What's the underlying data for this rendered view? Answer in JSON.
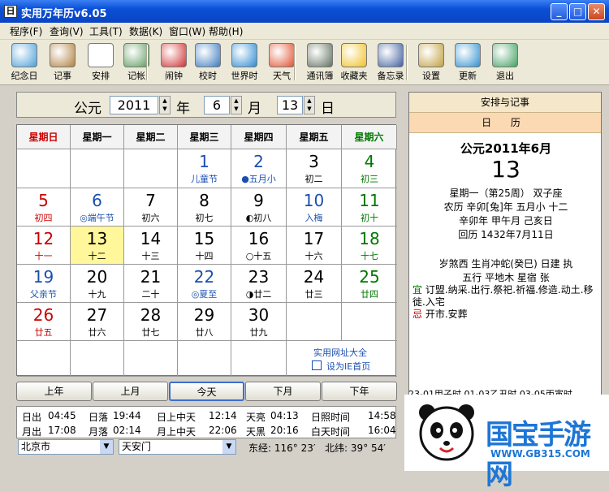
{
  "window": {
    "title": "实用万年历v6.05",
    "icon_text": "日"
  },
  "menu": [
    "程序(F)",
    "查询(V)",
    "工具(T)",
    "数据(K)",
    "窗口(W)",
    "帮助(H)"
  ],
  "toolbar": [
    {
      "label": "纪念日",
      "icon": "memorial-icon",
      "color": "#4a9fd8"
    },
    {
      "label": "记事",
      "icon": "notes-icon",
      "color": "#b08040"
    },
    {
      "label": "安排",
      "icon": "schedule-icon",
      "color": "#ffffff"
    },
    {
      "label": "记帐",
      "icon": "ledger-icon",
      "color": "#5a9a5a"
    },
    {
      "label": "闹钟",
      "icon": "alarm-icon",
      "color": "#d03030"
    },
    {
      "label": "校时",
      "icon": "clock-sync-icon",
      "color": "#3a7ac0"
    },
    {
      "label": "世界时",
      "icon": "globe-icon",
      "color": "#2a8ad0"
    },
    {
      "label": "天气",
      "icon": "weather-icon",
      "color": "#e05030"
    },
    {
      "label": "通讯簿",
      "icon": "address-book-icon",
      "color": "#607060"
    },
    {
      "label": "收藏夹",
      "icon": "favorites-icon",
      "color": "#f0c020"
    },
    {
      "label": "备忘录",
      "icon": "memo-icon",
      "color": "#4060a0"
    },
    {
      "label": "设置",
      "icon": "settings-icon",
      "color": "#c0a040"
    },
    {
      "label": "更新",
      "icon": "update-icon",
      "color": "#3090d0"
    },
    {
      "label": "退出",
      "icon": "exit-icon",
      "color": "#40a060"
    }
  ],
  "date": {
    "era": "公元",
    "year": "2011",
    "year_unit": "年",
    "month": "6",
    "month_unit": "月",
    "day": "13",
    "day_unit": "日"
  },
  "weekdays": [
    {
      "t": "星期日",
      "c": "#cc0000"
    },
    {
      "t": "星期一",
      "c": "#000"
    },
    {
      "t": "星期二",
      "c": "#000"
    },
    {
      "t": "星期三",
      "c": "#000"
    },
    {
      "t": "星期四",
      "c": "#000"
    },
    {
      "t": "星期五",
      "c": "#000"
    },
    {
      "t": "星期六",
      "c": "#007700"
    }
  ],
  "days": [
    {
      "d": "1",
      "l": "儿童节",
      "c": "#1a4fb0",
      "lc": "#1a4fb0"
    },
    {
      "d": "2",
      "l": "●五月小",
      "c": "#1a4fb0",
      "lc": "#1a4fb0"
    },
    {
      "d": "3",
      "l": "初二",
      "c": "#000",
      "lc": "#000"
    },
    {
      "d": "4",
      "l": "初三",
      "c": "#007700",
      "lc": "#007700"
    },
    {
      "d": "5",
      "l": "初四",
      "c": "#cc0000",
      "lc": "#cc0000"
    },
    {
      "d": "6",
      "l": "◎端午节",
      "c": "#1a4fb0",
      "lc": "#1a4fb0"
    },
    {
      "d": "7",
      "l": "初六",
      "c": "#000",
      "lc": "#000"
    },
    {
      "d": "8",
      "l": "初七",
      "c": "#000",
      "lc": "#000"
    },
    {
      "d": "9",
      "l": "◐初八",
      "c": "#000",
      "lc": "#000"
    },
    {
      "d": "10",
      "l": "入梅",
      "c": "#1a4fb0",
      "lc": "#1a4fb0"
    },
    {
      "d": "11",
      "l": "初十",
      "c": "#007700",
      "lc": "#007700"
    },
    {
      "d": "12",
      "l": "十一",
      "c": "#cc0000",
      "lc": "#cc0000"
    },
    {
      "d": "13",
      "l": "十二",
      "c": "#000",
      "lc": "#000"
    },
    {
      "d": "14",
      "l": "十三",
      "c": "#000",
      "lc": "#000"
    },
    {
      "d": "15",
      "l": "十四",
      "c": "#000",
      "lc": "#000"
    },
    {
      "d": "16",
      "l": "○十五",
      "c": "#000",
      "lc": "#000"
    },
    {
      "d": "17",
      "l": "十六",
      "c": "#000",
      "lc": "#000"
    },
    {
      "d": "18",
      "l": "十七",
      "c": "#007700",
      "lc": "#007700"
    },
    {
      "d": "19",
      "l": "父亲节",
      "c": "#1a4fb0",
      "lc": "#1a4fb0"
    },
    {
      "d": "20",
      "l": "十九",
      "c": "#000",
      "lc": "#000"
    },
    {
      "d": "21",
      "l": "二十",
      "c": "#000",
      "lc": "#000"
    },
    {
      "d": "22",
      "l": "◎夏至",
      "c": "#1a4fb0",
      "lc": "#1a4fb0"
    },
    {
      "d": "23",
      "l": "◑廿二",
      "c": "#000",
      "lc": "#000"
    },
    {
      "d": "24",
      "l": "廿三",
      "c": "#000",
      "lc": "#000"
    },
    {
      "d": "25",
      "l": "廿四",
      "c": "#007700",
      "lc": "#007700"
    },
    {
      "d": "26",
      "l": "廿五",
      "c": "#cc0000",
      "lc": "#cc0000"
    },
    {
      "d": "27",
      "l": "廿六",
      "c": "#000",
      "lc": "#000"
    },
    {
      "d": "28",
      "l": "廿七",
      "c": "#000",
      "lc": "#000"
    },
    {
      "d": "29",
      "l": "廿八",
      "c": "#000",
      "lc": "#000"
    },
    {
      "d": "30",
      "l": "廿九",
      "c": "#000",
      "lc": "#000"
    }
  ],
  "first_weekday": 3,
  "selected_day": "13",
  "links": {
    "sites": "实用网址大全",
    "homepage": "设为IE首页"
  },
  "nav": {
    "prev_year": "上年",
    "prev_month": "上月",
    "today": "今天",
    "next_month": "下月",
    "next_year": "下年"
  },
  "sun": {
    "row1": [
      [
        "日出",
        "04:45"
      ],
      [
        "日落",
        "19:44"
      ],
      [
        "日上中天",
        "12:14"
      ],
      [
        "天亮",
        "04:13"
      ],
      [
        "日照时间",
        "14:58"
      ]
    ],
    "row2": [
      [
        "月出",
        "17:08"
      ],
      [
        "月落",
        "02:14"
      ],
      [
        "月上中天",
        "22:06"
      ],
      [
        "天黑",
        "20:16"
      ],
      [
        "白天时间",
        "16:04"
      ]
    ]
  },
  "location": {
    "city": "北京市",
    "district": "天安门",
    "lon_label": "东经:",
    "lon": "116° 23′",
    "lat_label": "北纬:",
    "lat": "39° 54′"
  },
  "panel": {
    "header": "安排与记事",
    "sub": "日 历",
    "month_line": "公元2011年6月",
    "big_day": "13",
    "line1": "星期一（第25周） 双子座",
    "line2": "农历 辛卯[兔]年 五月小 十二",
    "line3": "辛卯年 甲午月 己亥日",
    "line4": "回历 1432年7月11日",
    "line5": "岁煞西 生肖冲蛇(癸巳)  日建 执",
    "line6": "五行 平地木   星宿 张",
    "yi_label": "宜",
    "yi": "订盟.纳采.出行.祭祀.祈福.修造.动土.移徙.入宅",
    "ji_label": "忌",
    "ji": "开市.安葬",
    "bottom": "23-01甲子时 01-03乙丑时 03-05丙寅时"
  },
  "watermark": {
    "brand": "国宝手游网",
    "url": "WWW.GB315.COM"
  }
}
